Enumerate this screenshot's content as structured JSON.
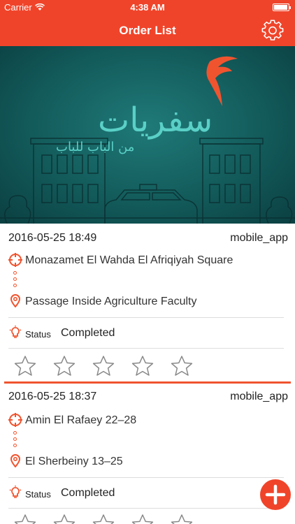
{
  "status_bar": {
    "carrier": "Carrier",
    "time": "4:38 AM",
    "battery_level": 0.95
  },
  "nav": {
    "title": "Order List",
    "settings_icon": "gear-icon"
  },
  "banner": {
    "logo_text": "سفريات",
    "logo_subtitle": "من الباب للباب"
  },
  "orders": [
    {
      "date": "2016-05-25 18:49",
      "source": "mobile_app",
      "pickup": "Monazamet El Wahda El Afriqiyah Square",
      "dropoff": "Passage Inside Agriculture Faculty",
      "status_label": "Status",
      "status_value": "Completed",
      "rating": 0
    },
    {
      "date": "2016-05-25 18:37",
      "source": "mobile_app",
      "pickup": "Amin El Rafaey 22–28",
      "dropoff": "El Sherbeiny 13–25",
      "status_label": "Status",
      "status_value": "Completed",
      "rating": 0
    }
  ],
  "colors": {
    "primary": "#f0442a",
    "accent": "#f0542f",
    "banner": "#135b5b"
  }
}
